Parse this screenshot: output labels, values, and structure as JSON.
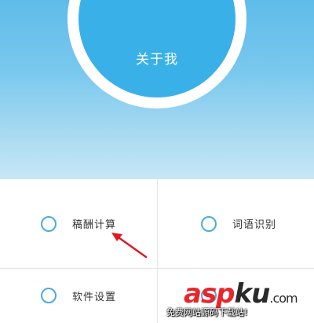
{
  "profile": {
    "label": "关于我"
  },
  "menu": {
    "items": [
      {
        "label": "稿酬计算"
      },
      {
        "label": "词语识别"
      },
      {
        "label": "软件设置"
      },
      {
        "label": ""
      }
    ]
  },
  "colors": {
    "header_top": "#5fbce9",
    "header_bottom": "#c7e7f6",
    "avatar_fill": "#3ab0e8",
    "ring_stroke": "#4aace0",
    "arrow": "#e0191f",
    "watermark_red": "#e8262b"
  },
  "icons": {
    "menu_marker": "circle-outline-icon",
    "annotation": "red-arrow-icon"
  },
  "watermark": {
    "logo_part1": "asp",
    "logo_part2": "ku",
    "logo_part3": ".com",
    "subtitle": "免费网站源码下载站!"
  }
}
